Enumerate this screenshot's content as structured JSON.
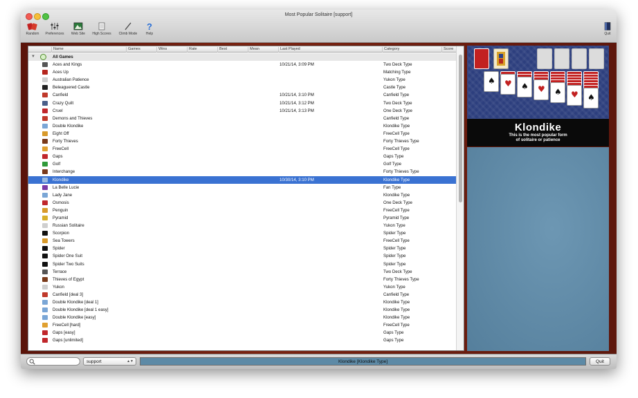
{
  "window": {
    "title": "Most Popular Solitaire [support]"
  },
  "toolbar": {
    "items": [
      {
        "label": "Random",
        "icon": "cards-icon"
      },
      {
        "label": "Preferences",
        "icon": "preferences-icon"
      },
      {
        "label": "Web Site",
        "icon": "website-icon"
      },
      {
        "label": "High Scores",
        "icon": "high-scores-icon"
      },
      {
        "label": "Climb Mode",
        "icon": "climb-mode-icon"
      },
      {
        "label": "Help",
        "icon": "help-icon"
      }
    ],
    "quit_label": "Quit"
  },
  "list": {
    "columns": [
      "Name",
      "Games",
      "Wins",
      "Rate",
      "Best",
      "Mean",
      "Last Played",
      "Category",
      "Score"
    ],
    "group_label": "All Games",
    "rows": [
      {
        "name": "Aces and Kings",
        "last_played": "10/21/14, 3:09 PM",
        "category": "Two Deck Type",
        "icon_color": "#555555"
      },
      {
        "name": "Aces Up",
        "last_played": "",
        "category": "Matching Type",
        "icon_color": "#b5261e"
      },
      {
        "name": "Australian Patience",
        "last_played": "",
        "category": "Yukon Type",
        "icon_color": "#cfcfcf"
      },
      {
        "name": "Beleaguered Castle",
        "last_played": "",
        "category": "Castle Type",
        "icon_color": "#222222"
      },
      {
        "name": "Canfield",
        "last_played": "10/21/14, 3:10 PM",
        "category": "Canfield Type",
        "icon_color": "#c0392b"
      },
      {
        "name": "Crazy Quilt",
        "last_played": "10/21/14, 3:12 PM",
        "category": "Two Deck Type",
        "icon_color": "#4a5f8a"
      },
      {
        "name": "Cruel",
        "last_played": "10/21/14, 3:13 PM",
        "category": "One Deck Type",
        "icon_color": "#c0262b"
      },
      {
        "name": "Demons and Thieves",
        "last_played": "",
        "category": "Canfield Type",
        "icon_color": "#c0392b"
      },
      {
        "name": "Double Klondike",
        "last_played": "",
        "category": "Klondike Type",
        "icon_color": "#7aa6d6"
      },
      {
        "name": "Eight Off",
        "last_played": "",
        "category": "FreeCell Type",
        "icon_color": "#d89a2b"
      },
      {
        "name": "Forty Thieves",
        "last_played": "",
        "category": "Forty Thieves Type",
        "icon_color": "#7a3a1a"
      },
      {
        "name": "FreeCell",
        "last_played": "",
        "category": "FreeCell Type",
        "icon_color": "#e0a030"
      },
      {
        "name": "Gaps",
        "last_played": "",
        "category": "Gaps Type",
        "icon_color": "#c0262b"
      },
      {
        "name": "Golf",
        "last_played": "",
        "category": "Golf Type",
        "icon_color": "#2f9a3a"
      },
      {
        "name": "Interchange",
        "last_played": "",
        "category": "Forty Thieves Type",
        "icon_color": "#7a3a1a"
      },
      {
        "name": "Klondike",
        "last_played": "10/30/14, 3:10 PM",
        "category": "Klondike Type",
        "icon_color": "#9bbbe0"
      },
      {
        "name": "La Belle Lucie",
        "last_played": "",
        "category": "Fan Type",
        "icon_color": "#7a3aa6"
      },
      {
        "name": "Lady Jane",
        "last_played": "",
        "category": "Klondike Type",
        "icon_color": "#7aa6d6"
      },
      {
        "name": "Osmosis",
        "last_played": "",
        "category": "One Deck Type",
        "icon_color": "#c0262b"
      },
      {
        "name": "Penguin",
        "last_played": "",
        "category": "FreeCell Type",
        "icon_color": "#d89a2b"
      },
      {
        "name": "Pyramid",
        "last_played": "",
        "category": "Pyramid Type",
        "icon_color": "#d8b02b"
      },
      {
        "name": "Russian Solitaire",
        "last_played": "",
        "category": "Yukon Type",
        "icon_color": "#cfcfcf"
      },
      {
        "name": "Scorpion",
        "last_played": "",
        "category": "Spider Type",
        "icon_color": "#111111"
      },
      {
        "name": "Sea Towers",
        "last_played": "",
        "category": "FreeCell Type",
        "icon_color": "#d89a2b"
      },
      {
        "name": "Spider",
        "last_played": "",
        "category": "Spider Type",
        "icon_color": "#111111"
      },
      {
        "name": "Spider One Suit",
        "last_played": "",
        "category": "Spider Type",
        "icon_color": "#111111"
      },
      {
        "name": "Spider Two Suits",
        "last_played": "",
        "category": "Spider Type",
        "icon_color": "#111111"
      },
      {
        "name": "Terrace",
        "last_played": "",
        "category": "Two Deck Type",
        "icon_color": "#555555"
      },
      {
        "name": "Thieves of Egypt",
        "last_played": "",
        "category": "Forty Thieves Type",
        "icon_color": "#7a3a1a"
      },
      {
        "name": "Yukon",
        "last_played": "",
        "category": "Yukon Type",
        "icon_color": "#cfcfcf"
      },
      {
        "name": "Canfield [deal 3]",
        "last_played": "",
        "category": "Canfield Type",
        "icon_color": "#c0392b"
      },
      {
        "name": "Double Klondike [deal 1]",
        "last_played": "",
        "category": "Klondike Type",
        "icon_color": "#7aa6d6"
      },
      {
        "name": "Double Klondike [deal 1 easy]",
        "last_played": "",
        "category": "Klondike Type",
        "icon_color": "#7aa6d6"
      },
      {
        "name": "Double Klondike [easy]",
        "last_played": "",
        "category": "Klondike Type",
        "icon_color": "#7aa6d6"
      },
      {
        "name": "FreeCell [hard]",
        "last_played": "",
        "category": "FreeCell Type",
        "icon_color": "#e0a030"
      },
      {
        "name": "Gaps [easy]",
        "last_played": "",
        "category": "Gaps Type",
        "icon_color": "#c0262b"
      },
      {
        "name": "Gaps [unlimited]",
        "last_played": "",
        "category": "Gaps Type",
        "icon_color": "#c0262b"
      }
    ],
    "selected_name": "Klondike"
  },
  "preview": {
    "game_title": "Klondike",
    "subtitle_line1": "This is the most popular form",
    "subtitle_line2": "of solitaire or patience"
  },
  "statusbar": {
    "search_placeholder": "",
    "profile_value": "support",
    "status_text": "Klondike [Klondike Type]",
    "quit_label": "Quit"
  }
}
